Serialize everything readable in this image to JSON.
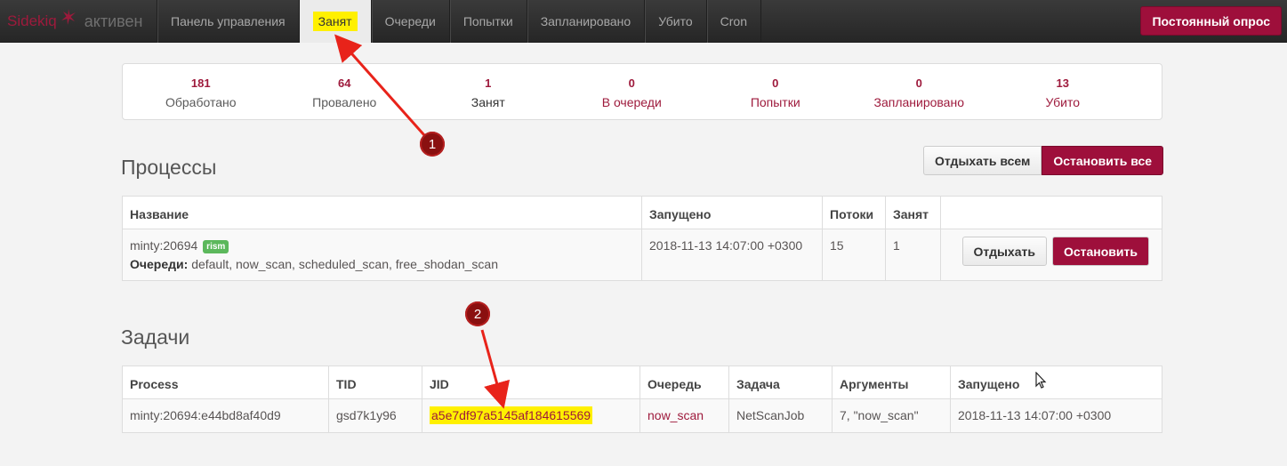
{
  "navbar": {
    "brand": "Sidekiq",
    "status": "активен",
    "items": [
      {
        "label": "Панель управления"
      },
      {
        "label": "Занят"
      },
      {
        "label": "Очереди"
      },
      {
        "label": "Попытки"
      },
      {
        "label": "Запланировано"
      },
      {
        "label": "Убито"
      },
      {
        "label": "Cron"
      }
    ],
    "poll_button": "Постоянный опрос"
  },
  "summary": [
    {
      "count": "181",
      "label": "Обработано"
    },
    {
      "count": "64",
      "label": "Провалено"
    },
    {
      "count": "1",
      "label": "Занят"
    },
    {
      "count": "0",
      "label": "В очереди"
    },
    {
      "count": "0",
      "label": "Попытки"
    },
    {
      "count": "0",
      "label": "Запланировано"
    },
    {
      "count": "13",
      "label": "Убито"
    }
  ],
  "processes": {
    "title": "Процессы",
    "quiet_all": "Отдыхать всем",
    "stop_all": "Остановить все",
    "headers": [
      "Название",
      "Запущено",
      "Потоки",
      "Занят",
      ""
    ],
    "rows": [
      {
        "name": "minty:20694",
        "tag": "rism",
        "queues_label": "Очереди:",
        "queues": "default, now_scan, scheduled_scan, free_shodan_scan",
        "started": "2018-11-13 14:07:00 +0300",
        "threads": "15",
        "busy": "1",
        "quiet": "Отдыхать",
        "stop": "Остановить"
      }
    ]
  },
  "jobs": {
    "title": "Задачи",
    "headers": [
      "Process",
      "TID",
      "JID",
      "Очередь",
      "Задача",
      "Аргументы",
      "Запущено"
    ],
    "rows": [
      {
        "process": "minty:20694:e44bd8af40d9",
        "tid": "gsd7k1y96",
        "jid": "a5e7df97a5145af184615569",
        "queue": "now_scan",
        "job": "NetScanJob",
        "args": "7, \"now_scan\"",
        "started": "2018-11-13 14:07:00 +0300"
      }
    ]
  },
  "annotations": {
    "marker1": "1",
    "marker2": "2",
    "color": "#e8231a"
  }
}
